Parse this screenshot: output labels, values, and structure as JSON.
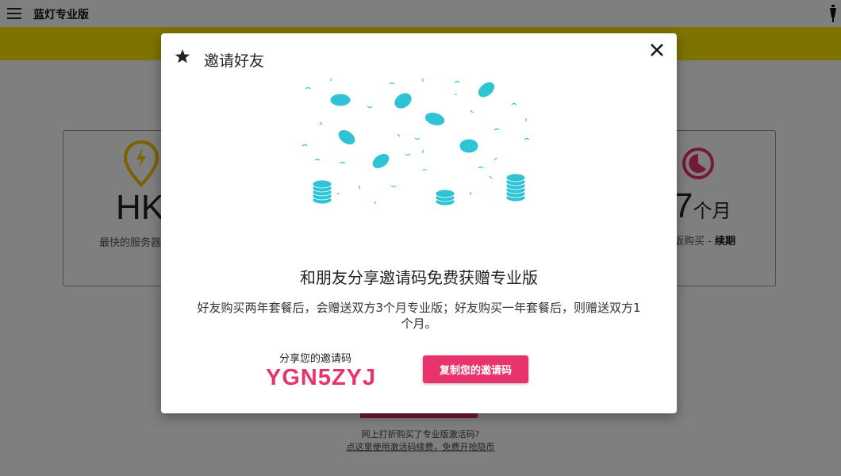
{
  "app": {
    "title": "蓝灯专业版"
  },
  "icons": {
    "menu": "hamburger-icon",
    "lantern": "lantern-icon",
    "star": "star-icon",
    "close": "close-icon",
    "pin": "location-pin-icon",
    "clock": "clock-icon"
  },
  "colors": {
    "accent": "#e8336d",
    "brand_yellow": "#ffe600",
    "coin": "#2ec4d6"
  },
  "background": {
    "left_card": {
      "big": "HK",
      "sub": "最快的服务器"
    },
    "right_card": {
      "big_num": "7",
      "big_unit": "个月",
      "sub_prefix": "版购买 - ",
      "sub_link": "续期"
    },
    "footer_line1": "网上打折购买了专业版激活码?",
    "footer_line2": "点这里使用激活码续费，免费开抢隐币"
  },
  "modal": {
    "title": "邀请好友",
    "headline": "和朋友分享邀请码免费获赠专业版",
    "description": "好友购买两年套餐后，会赠送双方3个月专业版；好友购买一年套餐后，则赠送双方1个月。",
    "code_label": "分享您的邀请码",
    "code_value": "YGN5ZYJ",
    "copy_button": "复制您的邀请码"
  }
}
